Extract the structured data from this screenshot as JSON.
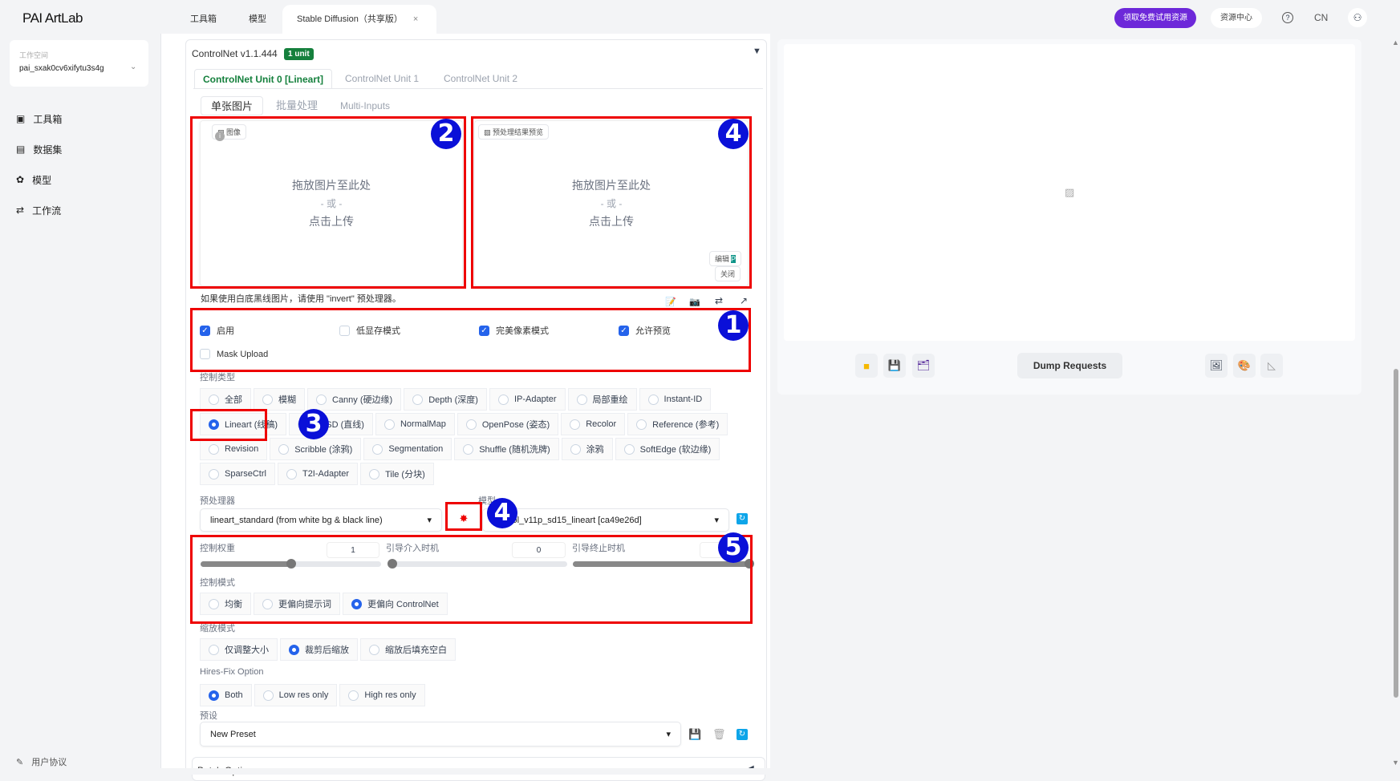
{
  "header": {
    "logo": "PAI ArtLab",
    "tabs": [
      "工具箱",
      "模型",
      "Stable Diffusion（共享版）"
    ],
    "close": "×",
    "trial_button": "领取免费试用资源",
    "resource_center": "资源中心",
    "lang": "CN"
  },
  "sidebar": {
    "workspace_label": "工作空间",
    "workspace_value": "pai_sxak0cv6xifytu3s4g",
    "items": [
      "工具箱",
      "数据集",
      "模型",
      "工作流"
    ],
    "footer": "用户协议"
  },
  "controlnet": {
    "title": "ControlNet v1.1.444",
    "badge": "1 unit",
    "unit_tabs": [
      "ControlNet Unit 0 [Lineart]",
      "ControlNet Unit 1",
      "ControlNet Unit 2"
    ],
    "sub_tabs": [
      "单张图片",
      "批量处理",
      "Multi-Inputs"
    ],
    "image_chip": "图像",
    "preview_chip": "预处理结果预览",
    "drop_line1": "拖放图片至此处",
    "drop_line2": "- 或 -",
    "drop_line3": "点击上传",
    "edit": "编辑",
    "close": "关闭",
    "hint": "如果使用白底黑线图片，请使用 \"invert\" 预处理器。",
    "checkboxes": [
      {
        "label": "启用",
        "checked": true
      },
      {
        "label": "低显存模式",
        "checked": false
      },
      {
        "label": "完美像素模式",
        "checked": true
      },
      {
        "label": "允许预览",
        "checked": true
      },
      {
        "label": "Mask Upload",
        "checked": false
      }
    ],
    "control_type_label": "控制类型",
    "control_types": [
      [
        "全部",
        "模糊",
        "Canny (硬边缘)",
        "Depth (深度)",
        "IP-Adapter",
        "局部重绘",
        "Instant-ID"
      ],
      [
        "Lineart (线稿)",
        "MLSD (直线)",
        "NormalMap",
        "OpenPose (姿态)",
        "Recolor",
        "Reference (参考)"
      ],
      [
        "Revision",
        "Scribble (涂鸦)",
        "Segmentation",
        "Shuffle (随机洗牌)",
        "涂鸦",
        "SoftEdge (软边缘)"
      ],
      [
        "SparseCtrl",
        "T2I-Adapter",
        "Tile (分块)"
      ]
    ],
    "selected_control_type": "Lineart (线稿)",
    "preprocessor_label": "预处理器",
    "preprocessor_value": "lineart_standard (from white bg & black line)",
    "model_label": "模型",
    "model_value": "control_v11p_sd15_lineart [ca49e26d]",
    "weight_label": "控制权重",
    "weight": 1,
    "start_label": "引导介入时机",
    "start": 0,
    "end_label": "引导终止时机",
    "end": 1,
    "control_mode_label": "控制模式",
    "control_modes": [
      "均衡",
      "更偏向提示词",
      "更偏向 ControlNet"
    ],
    "control_mode_selected": 2,
    "resize_label": "缩放模式",
    "resize_modes": [
      "仅调整大小",
      "裁剪后缩放",
      "缩放后填充空白"
    ],
    "resize_selected": 1,
    "hires_label": "Hires-Fix Option",
    "hires_modes": [
      "Both",
      "Low res only",
      "High res only"
    ],
    "hires_selected": 0,
    "preset_label": "预设",
    "preset_value": "New Preset",
    "batch_options": "Batch Options"
  },
  "right": {
    "dump_button": "Dump Requests"
  },
  "annotations": [
    "1",
    "2",
    "3",
    "4",
    "4",
    "5"
  ],
  "colors": {
    "accent": "#2563eb",
    "brand": "#6d28d9",
    "annotation": "#0a10d8",
    "highlight": "#e00000",
    "unit_active": "#15803d"
  }
}
